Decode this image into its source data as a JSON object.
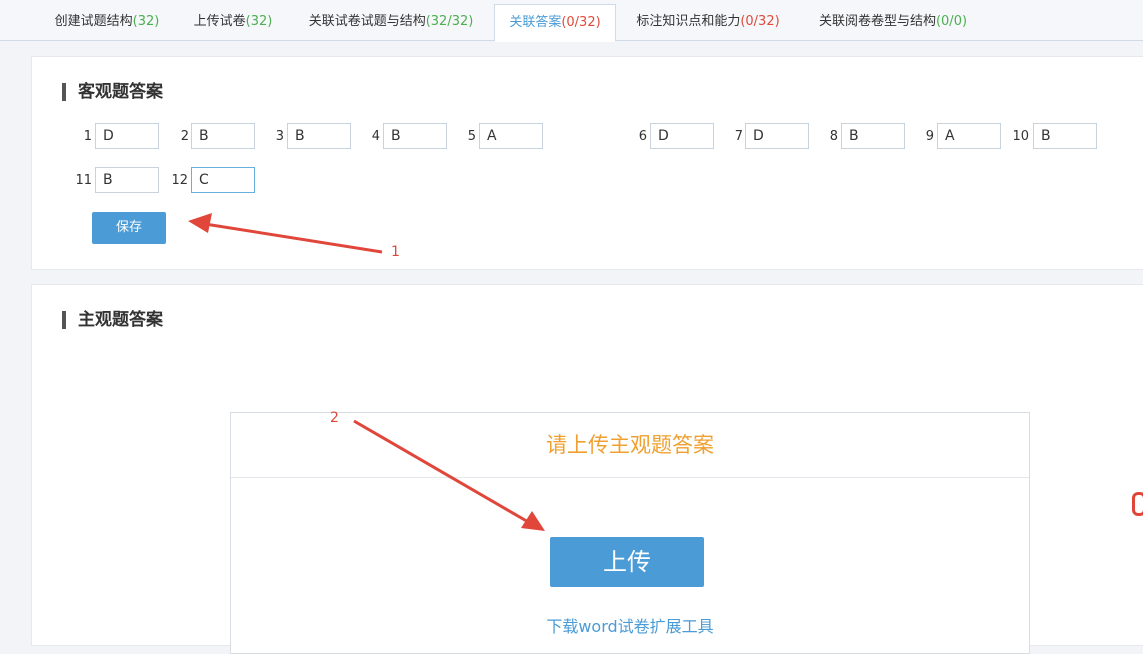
{
  "tabs": [
    {
      "label": "创建试题结构",
      "count": "(32)"
    },
    {
      "label": "上传试卷",
      "count": "(32)"
    },
    {
      "label": "关联试卷试题与结构",
      "count": "(32/32)"
    },
    {
      "label": "关联答案",
      "count": "(0/32)"
    },
    {
      "label": "标注知识点和能力",
      "count": "(0/32)"
    },
    {
      "label": "关联阅卷卷型与结构",
      "count": "(0/0)"
    }
  ],
  "objective": {
    "title": "客观题答案",
    "answers": [
      {
        "num": "1",
        "value": "D"
      },
      {
        "num": "2",
        "value": "B"
      },
      {
        "num": "3",
        "value": "B"
      },
      {
        "num": "4",
        "value": "B"
      },
      {
        "num": "5",
        "value": "A"
      },
      {
        "num": "6",
        "value": "D"
      },
      {
        "num": "7",
        "value": "D"
      },
      {
        "num": "8",
        "value": "B"
      },
      {
        "num": "9",
        "value": "A"
      },
      {
        "num": "10",
        "value": "B"
      },
      {
        "num": "11",
        "value": "B"
      },
      {
        "num": "12",
        "value": "C"
      }
    ],
    "save_label": "保存"
  },
  "subjective": {
    "title": "主观题答案",
    "prompt": "请上传主观题答案",
    "upload_label": "上传",
    "download_link": "下载word试卷扩展工具"
  },
  "annotations": {
    "one": "1",
    "two": "2"
  },
  "colors": {
    "accent": "#4a9bd6",
    "warning": "#f0a030",
    "arrow": "#e0463a",
    "count_green": "#4caf50"
  }
}
